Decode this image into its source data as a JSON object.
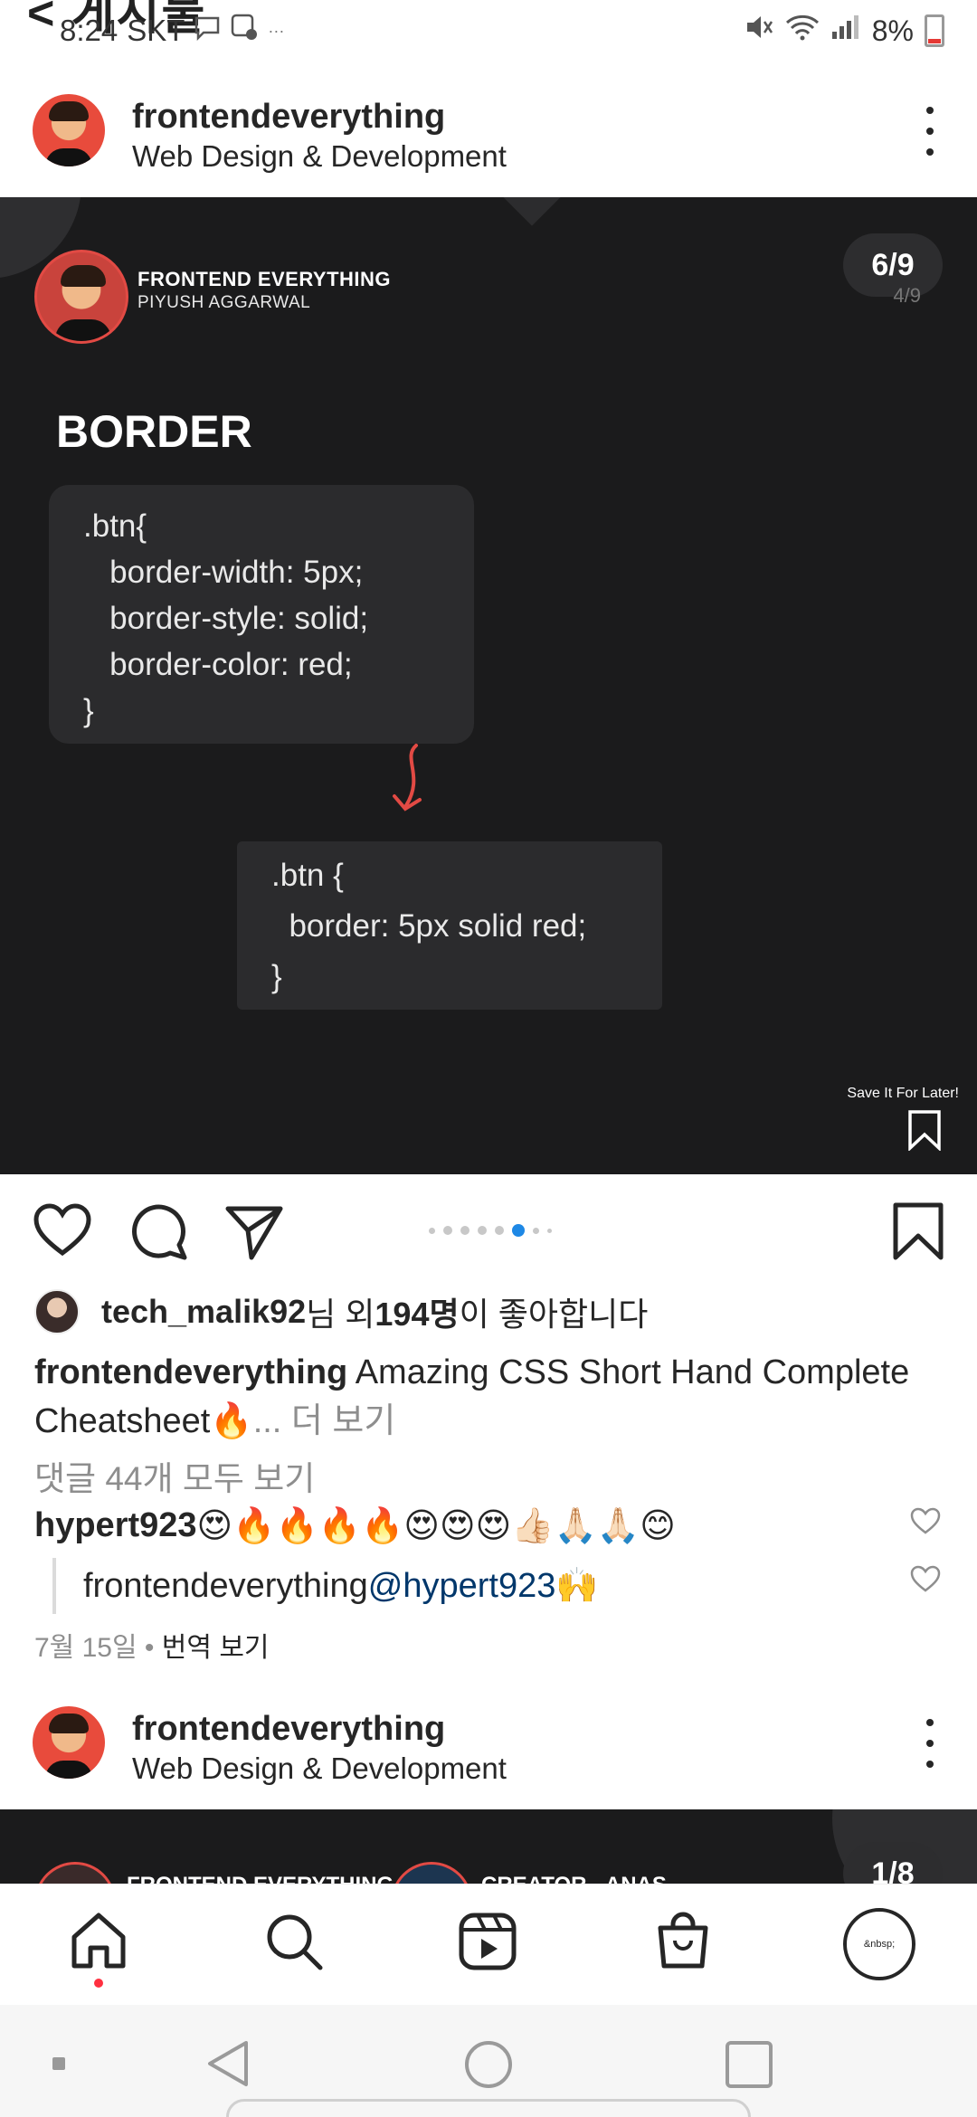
{
  "status_bar": {
    "peek_text": "<  게시물",
    "time": "8:24",
    "carrier": "SKT",
    "battery": "8%",
    "extra": "···"
  },
  "post": {
    "username": "frontendeverything",
    "subtitle": "Web Design & Development",
    "slide": {
      "brand_title": "FRONTEND EVERYTHING",
      "brand_sub": "PIYUSH AGGARWAL",
      "counter": "6/9",
      "counter_ghost": "4/9",
      "heading": "BORDER",
      "code1": [
        ".btn{",
        "   border-width: 5px;",
        "   border-style: solid;",
        "   border-color: red;",
        "}"
      ],
      "code2": [
        ".btn {",
        "  border: 5px solid red;",
        "}"
      ],
      "save_later": "Save It For Later!"
    },
    "carousel": {
      "total": 9,
      "active": 6
    },
    "likes": {
      "user": "tech_malik92",
      "middle": "님 외 ",
      "count": "194명",
      "tail": "이 좋아합니다"
    },
    "caption": {
      "user": "frontendeverything",
      "text": " Amazing CSS Short Hand Complete Cheatsheet🔥",
      "more": "... 더 보기"
    },
    "view_all_comments": "댓글 44개 모두 보기",
    "comments": [
      {
        "user": "hypert923",
        "text": " 😍🔥🔥🔥🔥😍😍😍👍🏻🙏🏻🙏🏻😊"
      },
      {
        "user": "frontendeverything",
        "mention": " @hypert923",
        "text": " 🙌"
      }
    ],
    "date": "7월 15일",
    "separator": " • ",
    "translate": "번역 보기"
  },
  "post2": {
    "username": "frontendeverything",
    "subtitle": "Web Design & Development",
    "counter": "1/8",
    "peek1": "FRONTEND EVERYTHING",
    "peek2": "CREATOR - ANAS"
  },
  "bottom_nav": {
    "profile_label": "&nbsp;"
  },
  "colors": {
    "accent_blue": "#1e88e5",
    "slide_bg": "#1b1b1c",
    "code_bg": "#2b2b2d",
    "red": "#e24a44"
  }
}
